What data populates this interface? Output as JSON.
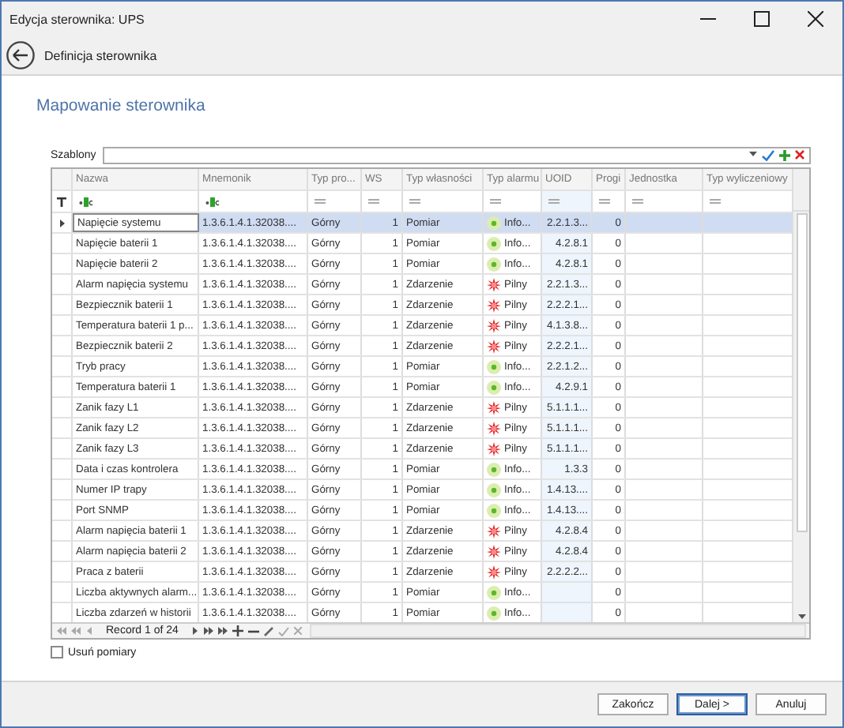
{
  "window": {
    "title": "Edycja sterownika: UPS"
  },
  "header": {
    "title": "Definicja sterownika"
  },
  "section_title": "Mapowanie sterownika",
  "templates": {
    "label": "Szablony"
  },
  "table": {
    "columns": [
      {
        "label": "Nazwa",
        "kind": "text"
      },
      {
        "label": "Mnemonik",
        "kind": "text"
      },
      {
        "label": "Typ pro...",
        "kind": "equals"
      },
      {
        "label": "WS",
        "kind": "equals"
      },
      {
        "label": "Typ własności",
        "kind": "equals"
      },
      {
        "label": "Typ alarmu",
        "kind": "equals"
      },
      {
        "label": "UOID",
        "kind": "equals"
      },
      {
        "label": "Progi",
        "kind": "equals"
      },
      {
        "label": "Jednostka",
        "kind": "equals"
      },
      {
        "label": "Typ wyliczeniowy",
        "kind": "equals"
      }
    ],
    "rows": [
      {
        "name": "Napięcie systemu",
        "mnemonic": "1.3.6.1.4.1.32038....",
        "direction": "Górny",
        "ws": "1",
        "property_type": "Pomiar",
        "kind": "info",
        "alarm": "Info...",
        "uoid": "2.2.1.3...",
        "progi": "0",
        "selected": true
      },
      {
        "name": "Napięcie baterii 1",
        "mnemonic": "1.3.6.1.4.1.32038....",
        "direction": "Górny",
        "ws": "1",
        "property_type": "Pomiar",
        "kind": "info",
        "alarm": "Info...",
        "uoid": "4.2.8.1",
        "progi": "0",
        "selected": false
      },
      {
        "name": "Napięcie baterii 2",
        "mnemonic": "1.3.6.1.4.1.32038....",
        "direction": "Górny",
        "ws": "1",
        "property_type": "Pomiar",
        "kind": "info",
        "alarm": "Info...",
        "uoid": "4.2.8.1",
        "progi": "0",
        "selected": false
      },
      {
        "name": "Alarm napięcia systemu",
        "mnemonic": "1.3.6.1.4.1.32038....",
        "direction": "Górny",
        "ws": "1",
        "property_type": "Zdarzenie",
        "kind": "urgent",
        "alarm": "Pilny",
        "uoid": "2.2.1.3...",
        "progi": "0",
        "selected": false
      },
      {
        "name": "Bezpiecznik baterii 1",
        "mnemonic": "1.3.6.1.4.1.32038....",
        "direction": "Górny",
        "ws": "1",
        "property_type": "Zdarzenie",
        "kind": "urgent",
        "alarm": "Pilny",
        "uoid": "2.2.2.1...",
        "progi": "0",
        "selected": false
      },
      {
        "name": "Temperatura baterii 1 p...",
        "mnemonic": "1.3.6.1.4.1.32038....",
        "direction": "Górny",
        "ws": "1",
        "property_type": "Zdarzenie",
        "kind": "urgent",
        "alarm": "Pilny",
        "uoid": "4.1.3.8...",
        "progi": "0",
        "selected": false
      },
      {
        "name": "Bezpiecznik baterii 2",
        "mnemonic": "1.3.6.1.4.1.32038....",
        "direction": "Górny",
        "ws": "1",
        "property_type": "Zdarzenie",
        "kind": "urgent",
        "alarm": "Pilny",
        "uoid": "2.2.2.1...",
        "progi": "0",
        "selected": false
      },
      {
        "name": "Tryb pracy",
        "mnemonic": "1.3.6.1.4.1.32038....",
        "direction": "Górny",
        "ws": "1",
        "property_type": "Pomiar",
        "kind": "info",
        "alarm": "Info...",
        "uoid": "2.2.1.2...",
        "progi": "0",
        "selected": false
      },
      {
        "name": "Temperatura baterii 1",
        "mnemonic": "1.3.6.1.4.1.32038....",
        "direction": "Górny",
        "ws": "1",
        "property_type": "Pomiar",
        "kind": "info",
        "alarm": "Info...",
        "uoid": "4.2.9.1",
        "progi": "0",
        "selected": false
      },
      {
        "name": "Zanik fazy L1",
        "mnemonic": "1.3.6.1.4.1.32038....",
        "direction": "Górny",
        "ws": "1",
        "property_type": "Zdarzenie",
        "kind": "urgent",
        "alarm": "Pilny",
        "uoid": "5.1.1.1...",
        "progi": "0",
        "selected": false
      },
      {
        "name": "Zanik fazy L2",
        "mnemonic": "1.3.6.1.4.1.32038....",
        "direction": "Górny",
        "ws": "1",
        "property_type": "Zdarzenie",
        "kind": "urgent",
        "alarm": "Pilny",
        "uoid": "5.1.1.1...",
        "progi": "0",
        "selected": false
      },
      {
        "name": "Zanik fazy L3",
        "mnemonic": "1.3.6.1.4.1.32038....",
        "direction": "Górny",
        "ws": "1",
        "property_type": "Zdarzenie",
        "kind": "urgent",
        "alarm": "Pilny",
        "uoid": "5.1.1.1...",
        "progi": "0",
        "selected": false
      },
      {
        "name": "Data i czas kontrolera",
        "mnemonic": "1.3.6.1.4.1.32038....",
        "direction": "Górny",
        "ws": "1",
        "property_type": "Pomiar",
        "kind": "info",
        "alarm": "Info...",
        "uoid": "1.3.3",
        "progi": "0",
        "selected": false
      },
      {
        "name": "Numer IP trapy",
        "mnemonic": "1.3.6.1.4.1.32038....",
        "direction": "Górny",
        "ws": "1",
        "property_type": "Pomiar",
        "kind": "info",
        "alarm": "Info...",
        "uoid": "1.4.13....",
        "progi": "0",
        "selected": false
      },
      {
        "name": "Port SNMP",
        "mnemonic": "1.3.6.1.4.1.32038....",
        "direction": "Górny",
        "ws": "1",
        "property_type": "Pomiar",
        "kind": "info",
        "alarm": "Info...",
        "uoid": "1.4.13....",
        "progi": "0",
        "selected": false
      },
      {
        "name": "Alarm napięcia baterii 1",
        "mnemonic": "1.3.6.1.4.1.32038....",
        "direction": "Górny",
        "ws": "1",
        "property_type": "Zdarzenie",
        "kind": "urgent",
        "alarm": "Pilny",
        "uoid": "4.2.8.4",
        "progi": "0",
        "selected": false
      },
      {
        "name": "Alarm napięcia baterii 2",
        "mnemonic": "1.3.6.1.4.1.32038....",
        "direction": "Górny",
        "ws": "1",
        "property_type": "Zdarzenie",
        "kind": "urgent",
        "alarm": "Pilny",
        "uoid": "4.2.8.4",
        "progi": "0",
        "selected": false
      },
      {
        "name": "Praca z baterii",
        "mnemonic": "1.3.6.1.4.1.32038....",
        "direction": "Górny",
        "ws": "1",
        "property_type": "Zdarzenie",
        "kind": "urgent",
        "alarm": "Pilny",
        "uoid": "2.2.2.2...",
        "progi": "0",
        "selected": false
      },
      {
        "name": "Liczba aktywnych alarm...",
        "mnemonic": "1.3.6.1.4.1.32038....",
        "direction": "Górny",
        "ws": "1",
        "property_type": "Pomiar",
        "kind": "info",
        "alarm": "Info...",
        "progi": "0",
        "selected": false
      },
      {
        "name": "Liczba zdarzeń w historii",
        "mnemonic": "1.3.6.1.4.1.32038....",
        "direction": "Górny",
        "ws": "1",
        "property_type": "Pomiar",
        "kind": "info",
        "alarm": "Info...",
        "progi": "0",
        "selected": false
      }
    ]
  },
  "navigator": {
    "record": "Record 1 of 24"
  },
  "remove_measurements": {
    "label": "Usuń pomiary",
    "checked": false
  },
  "buttons": [
    {
      "label": "Zakończ",
      "default": false
    },
    {
      "label": "Dalej >",
      "default": true
    },
    {
      "label": "Anuluj",
      "default": false
    }
  ]
}
